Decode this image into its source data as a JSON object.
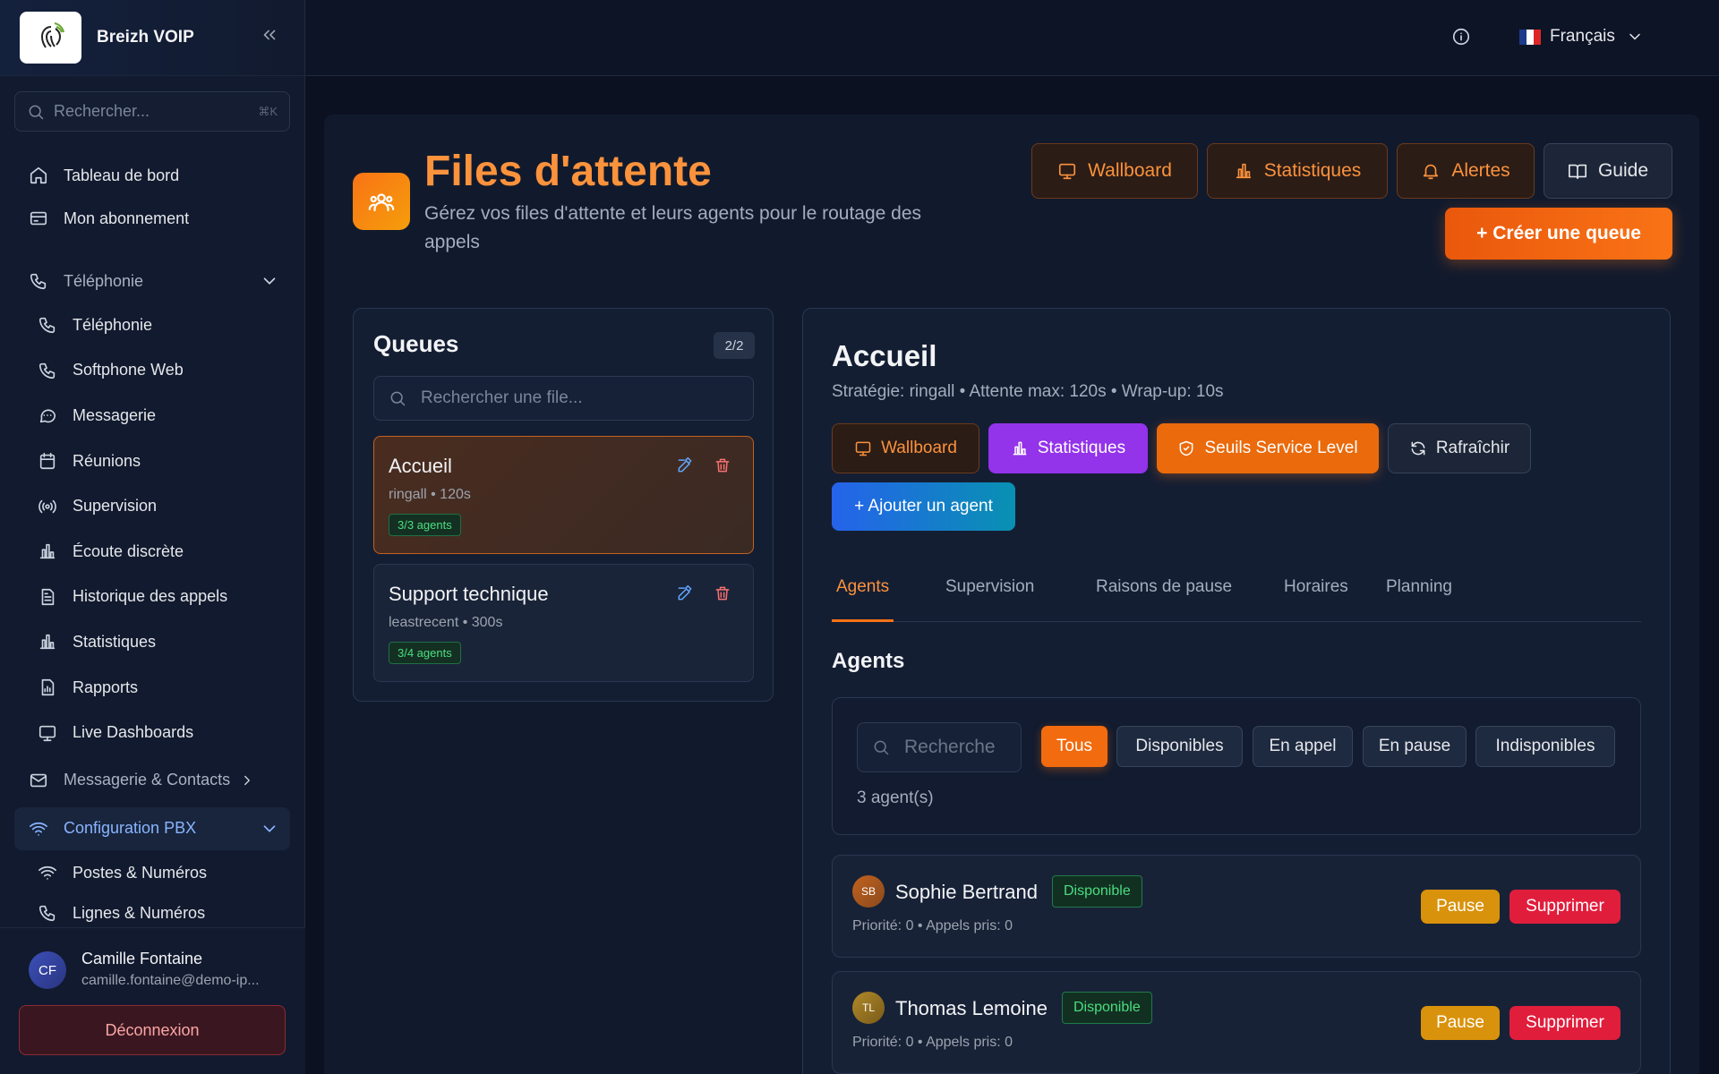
{
  "app": {
    "name": "Breizh VOIP"
  },
  "sidebar": {
    "search_placeholder": "Rechercher...",
    "search_shortcut": "⌘K",
    "items": [
      {
        "label": "Tableau de bord"
      },
      {
        "label": "Mon abonnement"
      },
      {
        "label": "Téléphonie"
      },
      {
        "label": "Téléphonie"
      },
      {
        "label": "Softphone Web"
      },
      {
        "label": "Messagerie"
      },
      {
        "label": "Réunions"
      },
      {
        "label": "Supervision"
      },
      {
        "label": "Écoute discrète"
      },
      {
        "label": "Historique des appels"
      },
      {
        "label": "Statistiques"
      },
      {
        "label": "Rapports"
      },
      {
        "label": "Live Dashboards"
      },
      {
        "label": "Messagerie & Contacts"
      },
      {
        "label": "Configuration PBX"
      },
      {
        "label": "Postes & Numéros"
      },
      {
        "label": "Lignes & Numéros"
      }
    ]
  },
  "user": {
    "initials": "CF",
    "name": "Camille Fontaine",
    "email": "camille.fontaine@demo-ip...",
    "logout": "Déconnexion"
  },
  "topbar": {
    "language": "Français"
  },
  "page": {
    "title": "Files d'attente",
    "subtitle": "Gérez vos files d'attente et leurs agents pour le routage des appels",
    "buttons": {
      "wallboard": "Wallboard",
      "stats": "Statistiques",
      "alerts": "Alertes",
      "guide": "Guide",
      "create": "+ Créer une queue"
    }
  },
  "queues": {
    "title": "Queues",
    "count": "2/2",
    "search_placeholder": "Rechercher une file...",
    "items": [
      {
        "name": "Accueil",
        "meta": "ringall • 120s",
        "agents": "3/3 agents"
      },
      {
        "name": "Support technique",
        "meta": "leastrecent • 300s",
        "agents": "3/4 agents"
      }
    ]
  },
  "detail": {
    "title": "Accueil",
    "meta": "Stratégie: ringall • Attente max: 120s • Wrap-up: 10s",
    "buttons": {
      "wallboard": "Wallboard",
      "stats": "Statistiques",
      "sla": "Seuils Service Level",
      "refresh": "Rafraîchir",
      "add_agent": "+ Ajouter un agent"
    },
    "tabs": [
      "Agents",
      "Supervision",
      "Raisons de pause",
      "Horaires",
      "Planning"
    ],
    "section_title": "Agents",
    "search_placeholder": "Recherche",
    "filters": [
      "Tous",
      "Disponibles",
      "En appel",
      "En pause",
      "Indisponibles"
    ],
    "agent_count": "3 agent(s)",
    "agents": [
      {
        "initials": "SB",
        "name": "Sophie Bertrand",
        "status": "Disponible",
        "meta": "Priorité: 0 • Appels pris: 0",
        "pause": "Pause",
        "delete": "Supprimer"
      },
      {
        "initials": "TL",
        "name": "Thomas Lemoine",
        "status": "Disponible",
        "meta": "Priorité: 0 • Appels pris: 0",
        "pause": "Pause",
        "delete": "Supprimer"
      }
    ]
  },
  "colors": {
    "accent": "#f97316",
    "success": "#4ade80",
    "danger": "#e11d3c",
    "purple": "#9333ea",
    "blue": "#2563eb"
  }
}
